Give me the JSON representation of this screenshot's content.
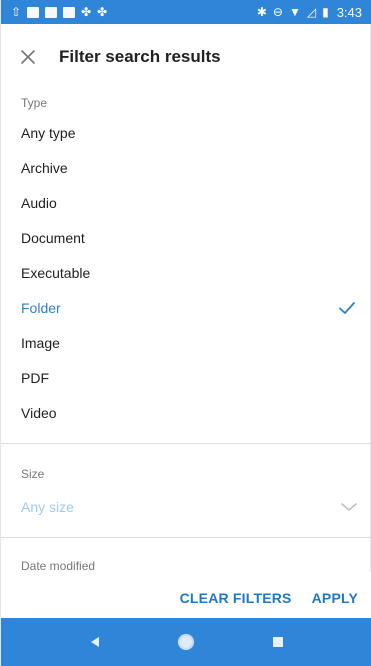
{
  "status_bar": {
    "time": "3:43",
    "left_icons": [
      "upload-icon",
      "outlook-icon",
      "gallery-icon",
      "image-icon",
      "app-icon",
      "app-icon"
    ],
    "right_icons": [
      "bluetooth-icon",
      "dnd-icon",
      "wifi-icon",
      "signal-icon",
      "battery-icon"
    ]
  },
  "header": {
    "title": "Filter search results"
  },
  "type_section": {
    "label": "Type",
    "options": [
      {
        "label": "Any type",
        "selected": false
      },
      {
        "label": "Archive",
        "selected": false
      },
      {
        "label": "Audio",
        "selected": false
      },
      {
        "label": "Document",
        "selected": false
      },
      {
        "label": "Executable",
        "selected": false
      },
      {
        "label": "Folder",
        "selected": true
      },
      {
        "label": "Image",
        "selected": false
      },
      {
        "label": "PDF",
        "selected": false
      },
      {
        "label": "Video",
        "selected": false
      }
    ]
  },
  "size_section": {
    "label": "Size",
    "value": "Any size"
  },
  "date_section": {
    "label": "Date modified"
  },
  "actions": {
    "clear": "CLEAR FILTERS",
    "apply": "APPLY"
  },
  "colors": {
    "accent": "#2c82c9",
    "bar": "#2f86d8"
  }
}
